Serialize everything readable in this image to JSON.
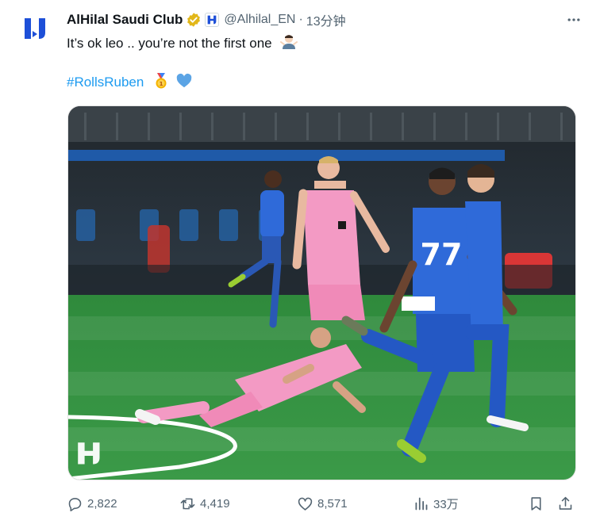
{
  "author": {
    "display_name": "AlHilal Saudi Club",
    "handle": "@Alhilal_EN",
    "separator": "·",
    "time": "13分钟"
  },
  "tweet": {
    "text": "It’s ok leo .. you’re not the first one",
    "hashtag": "#RollsRuben"
  },
  "actions": {
    "replies": "2,822",
    "retweets": "4,419",
    "likes": "8,571",
    "views": "33万"
  },
  "icons": {
    "avatar": "alhilal-logo-icon",
    "verified": "verified-badge-icon",
    "affiliation": "affiliation-badge-icon",
    "more": "more-icon",
    "reply": "reply-icon",
    "retweet": "retweet-icon",
    "like": "like-icon",
    "views": "views-icon",
    "bookmark": "bookmark-icon",
    "share": "share-icon"
  },
  "colors": {
    "brand_blue": "#1d4fd8",
    "link": "#1d9bf0",
    "verified_gold": "#e2b719",
    "muted": "#536471",
    "text": "#0f1419"
  }
}
